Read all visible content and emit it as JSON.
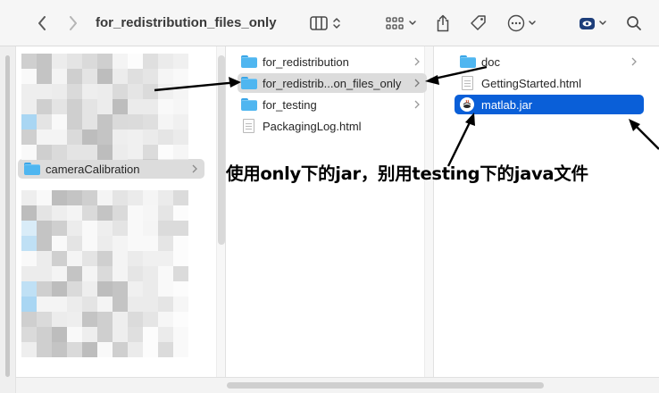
{
  "window": {
    "title": "for_redistribution_files_only"
  },
  "toolbar": {
    "icons": [
      "back-chevron-icon",
      "forward-chevron-icon",
      "column-view-icon",
      "group-grid-icon",
      "share-icon",
      "tag-icon",
      "more-actions-icon",
      "eye-extension-icon",
      "search-icon"
    ]
  },
  "sidebar_column": {
    "items": [
      {
        "label": "cameraCalibration",
        "icon": "folder-icon",
        "selected": true,
        "has_children": true
      }
    ]
  },
  "middle_column": {
    "items": [
      {
        "label": "for_redistribution",
        "icon": "folder-icon",
        "selected": false,
        "has_children": true
      },
      {
        "label": "for_redistrib...on_files_only",
        "icon": "folder-icon",
        "selected": true,
        "has_children": true
      },
      {
        "label": "for_testing",
        "icon": "folder-icon",
        "selected": false,
        "has_children": true
      },
      {
        "label": "PackagingLog.html",
        "icon": "html-file-icon",
        "selected": false,
        "has_children": false
      }
    ]
  },
  "right_column": {
    "items": [
      {
        "label": "doc",
        "icon": "folder-icon",
        "selected": false,
        "has_children": true
      },
      {
        "label": "GettingStarted.html",
        "icon": "html-file-icon",
        "selected": false,
        "has_children": false
      },
      {
        "label": "matlab.jar",
        "icon": "jar-file-icon",
        "selected": true,
        "has_children": false
      }
    ]
  },
  "annotation": {
    "text": "使用only下的jar，别用testing下的java文件"
  },
  "colors": {
    "selection_blue": "#0a5fd8",
    "selection_grey": "#dcdcdc",
    "folder_blue": "#4fb6f0",
    "annotation_text": "#000000"
  }
}
